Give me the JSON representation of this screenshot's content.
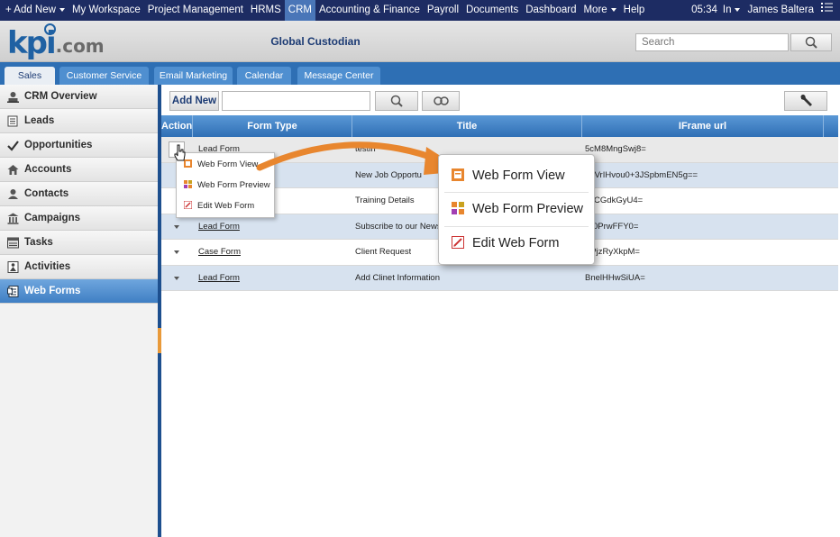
{
  "topbar": {
    "add_new": "+ Add New",
    "items": [
      "My Workspace",
      "Project Management",
      "HRMS",
      "CRM",
      "Accounting & Finance",
      "Payroll",
      "Documents",
      "Dashboard",
      "More",
      "Help"
    ],
    "active_item": "CRM",
    "time": "05:34",
    "status": "In",
    "user": "James Baltera"
  },
  "header": {
    "logo_main": "kpi",
    "logo_suffix": ".com",
    "company": "Global Custodian",
    "search_placeholder": "Search"
  },
  "tabs": [
    "Sales",
    "Customer Service",
    "Email Marketing",
    "Calendar",
    "Message Center"
  ],
  "active_tab": "Sales",
  "sidebar": {
    "items": [
      {
        "label": "CRM Overview",
        "icon": "crm-overview-icon"
      },
      {
        "label": "Leads",
        "icon": "leads-icon"
      },
      {
        "label": "Opportunities",
        "icon": "opportunities-icon"
      },
      {
        "label": "Accounts",
        "icon": "accounts-icon"
      },
      {
        "label": "Contacts",
        "icon": "contacts-icon"
      },
      {
        "label": "Campaigns",
        "icon": "campaigns-icon"
      },
      {
        "label": "Tasks",
        "icon": "tasks-icon"
      },
      {
        "label": "Activities",
        "icon": "activities-icon"
      },
      {
        "label": "Web Forms",
        "icon": "web-forms-icon"
      }
    ],
    "active_item": "Web Forms"
  },
  "toolbar": {
    "add_new": "Add New"
  },
  "table": {
    "columns": [
      "Action",
      "Form Type",
      "Title",
      "IFrame url"
    ],
    "rows": [
      {
        "form_type": "Lead Form",
        "title": "testin",
        "iframe": "5cM8MngSwj8="
      },
      {
        "form_type": "",
        "title": "New Job Opportu",
        "iframe": "4uVrIHvou0+3JSpbmEN5g=="
      },
      {
        "form_type": "",
        "title": "Training Details",
        "iframe": "c6CGdkGyU4="
      },
      {
        "form_type": "Lead Form",
        "title": "Subscribe to our News",
        "iframe": "/K0PrwFFY0="
      },
      {
        "form_type": "Case Form",
        "title": "Client Request",
        "iframe": "VPjzRyXkpM="
      },
      {
        "form_type": "Lead Form",
        "title": "Add Clinet Information",
        "iframe": "BnelHHwSiUA="
      }
    ]
  },
  "action_menu": {
    "items": [
      {
        "label": "Web Form View",
        "icon": "web-form-view-icon"
      },
      {
        "label": "Web Form Preview",
        "icon": "web-form-preview-icon"
      },
      {
        "label": "Edit Web Form",
        "icon": "edit-web-form-icon"
      }
    ]
  },
  "colors": {
    "topbar": "#1d2c63",
    "tabbar": "#2e6fb4",
    "accent_orange": "#e8862e",
    "active_side": "#3f7fc4"
  }
}
